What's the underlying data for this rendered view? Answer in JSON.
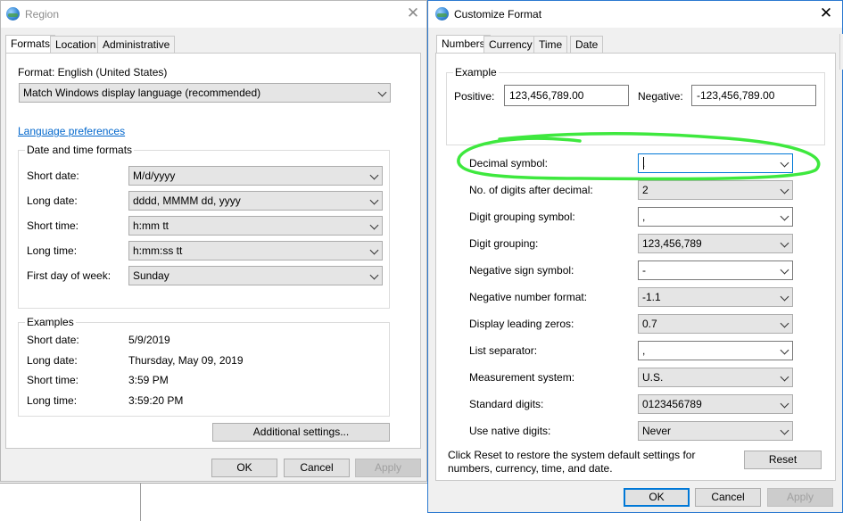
{
  "region": {
    "title": "Region",
    "tabs": [
      "Formats",
      "Location",
      "Administrative"
    ],
    "format_label": "Format: English (United States)",
    "format_value": "Match Windows display language (recommended)",
    "language_link": "Language preferences",
    "dt_group_title": "Date and time formats",
    "rows": [
      {
        "label": "Short date:",
        "value": "M/d/yyyy"
      },
      {
        "label": "Long date:",
        "value": "dddd, MMMM dd, yyyy"
      },
      {
        "label": "Short time:",
        "value": "h:mm tt"
      },
      {
        "label": "Long time:",
        "value": "h:mm:ss tt"
      },
      {
        "label": "First day of week:",
        "value": "Sunday"
      }
    ],
    "examples_title": "Examples",
    "examples": [
      {
        "label": "Short date:",
        "value": "5/9/2019"
      },
      {
        "label": "Long date:",
        "value": "Thursday, May 09, 2019"
      },
      {
        "label": "Short time:",
        "value": "3:59 PM"
      },
      {
        "label": "Long time:",
        "value": "3:59:20 PM"
      }
    ],
    "additional_settings": "Additional settings...",
    "ok": "OK",
    "cancel": "Cancel",
    "apply": "Apply"
  },
  "customize": {
    "title": "Customize Format",
    "tabs": [
      "Numbers",
      "Currency",
      "Time",
      "Date"
    ],
    "example_title": "Example",
    "positive_label": "Positive:",
    "positive_value": "123,456,789.00",
    "negative_label": "Negative:",
    "negative_value": "-123,456,789.00",
    "settings": [
      {
        "label": "Decimal symbol:",
        "value": "."
      },
      {
        "label": "No. of digits after decimal:",
        "value": "2"
      },
      {
        "label": "Digit grouping symbol:",
        "value": ","
      },
      {
        "label": "Digit grouping:",
        "value": "123,456,789"
      },
      {
        "label": "Negative sign symbol:",
        "value": "-"
      },
      {
        "label": "Negative number format:",
        "value": "-1.1"
      },
      {
        "label": "Display leading zeros:",
        "value": "0.7"
      },
      {
        "label": "List separator:",
        "value": ","
      },
      {
        "label": "Measurement system:",
        "value": "U.S."
      },
      {
        "label": "Standard digits:",
        "value": "0123456789"
      },
      {
        "label": "Use native digits:",
        "value": "Never"
      }
    ],
    "reset_note_1": "Click Reset to restore the system default settings for",
    "reset_note_2": "numbers, currency, time, and date.",
    "reset": "Reset",
    "ok": "OK",
    "cancel": "Cancel",
    "apply": "Apply"
  },
  "colors": {
    "annotation": "#3ee83e",
    "accent": "#0078d7",
    "link": "#0066cc"
  }
}
